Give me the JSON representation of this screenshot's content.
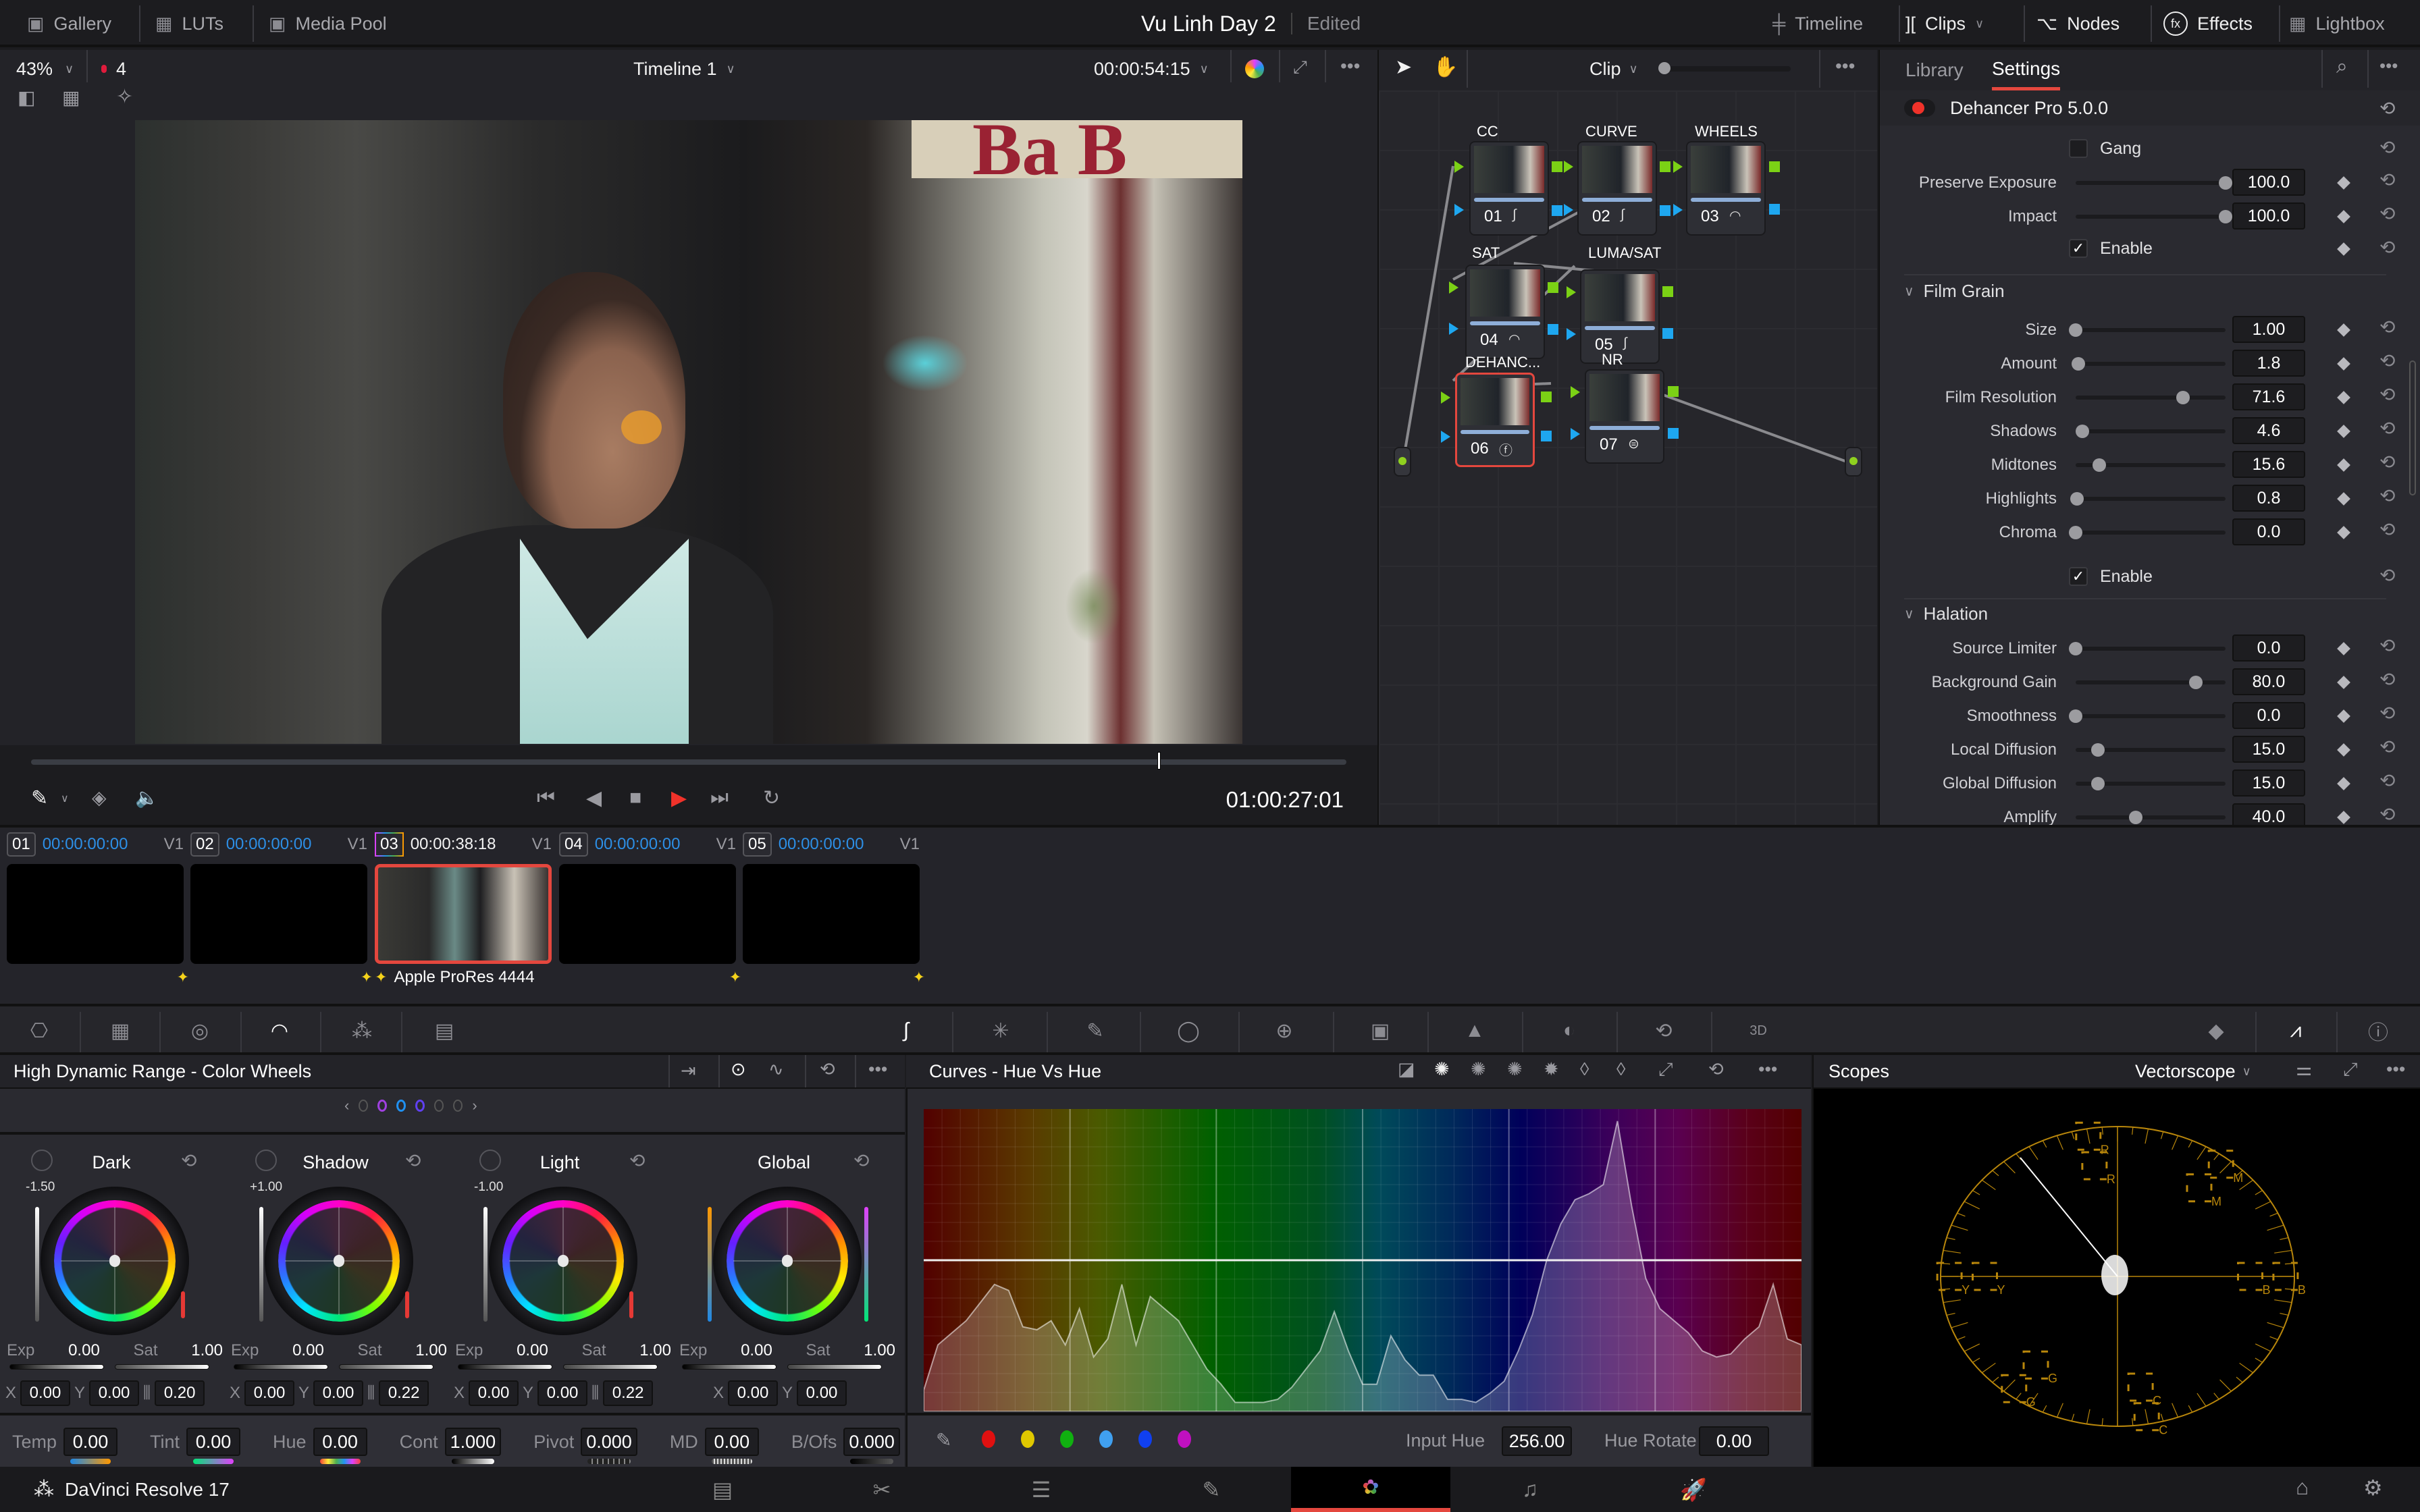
{
  "topbar": {
    "left_items": [
      {
        "label": "Gallery",
        "icon": "gallery-icon"
      },
      {
        "label": "LUTs",
        "icon": "luts-icon"
      },
      {
        "label": "Media Pool",
        "icon": "media-pool-icon"
      }
    ],
    "project_title": "Vu Linh Day 2",
    "project_status": "Edited",
    "right_items": [
      {
        "label": "Timeline",
        "icon": "timeline-icon",
        "active": false
      },
      {
        "label": "Clips",
        "icon": "clips-icon",
        "active": true,
        "dropdown": true
      },
      {
        "label": "Nodes",
        "icon": "nodes-icon",
        "active": true
      },
      {
        "label": "Effects",
        "icon": "effects-icon",
        "active": true
      },
      {
        "label": "Lightbox",
        "icon": "lightbox-icon",
        "active": false
      }
    ]
  },
  "viewer": {
    "zoom": "43%",
    "marker_count": "4",
    "timeline_name": "Timeline 1",
    "source_timecode": "00:00:54:15",
    "record_timecode": "01:00:27:01",
    "playhead_fraction": 0.86,
    "sign_text": "Ba B"
  },
  "node_editor": {
    "mode": "Clip",
    "nodes": [
      {
        "num": "01",
        "label": "CC",
        "icon": "curves-icon",
        "glyph": "∫"
      },
      {
        "num": "02",
        "label": "CURVE",
        "icon": "curves-icon",
        "glyph": "∫"
      },
      {
        "num": "03",
        "label": "WHEELS",
        "icon": "hdr-icon",
        "glyph": "◠"
      },
      {
        "num": "04",
        "label": "SAT",
        "icon": "hdr-icon",
        "glyph": "◠"
      },
      {
        "num": "05",
        "label": "LUMA/SAT",
        "icon": "curves-icon",
        "glyph": "∫"
      },
      {
        "num": "06",
        "label": "DEHANC...",
        "icon": "fx-icon",
        "glyph": "ⓕ",
        "selected": true
      },
      {
        "num": "07",
        "label": "NR",
        "icon": "noise-reduction-icon",
        "glyph": "⊜"
      }
    ]
  },
  "settings": {
    "tabs": [
      "Library",
      "Settings"
    ],
    "active_tab": "Settings",
    "plugin_name": "Dehancer Pro 5.0.0",
    "gang_label": "Gang",
    "gang_checked": false,
    "top_params": [
      {
        "label": "Preserve Exposure",
        "value": "100.0",
        "fraction": 1.0
      },
      {
        "label": "Impact",
        "value": "100.0",
        "fraction": 1.0
      }
    ],
    "enable_label": "Enable",
    "film_grain": {
      "title": "Film Grain",
      "params": [
        {
          "label": "Size",
          "value": "1.00",
          "fraction": 0.0
        },
        {
          "label": "Amount",
          "value": "1.8",
          "fraction": 0.02
        },
        {
          "label": "Film Resolution",
          "value": "71.6",
          "fraction": 0.716
        },
        {
          "label": "Shadows",
          "value": "4.6",
          "fraction": 0.046
        },
        {
          "label": "Midtones",
          "value": "15.6",
          "fraction": 0.156
        },
        {
          "label": "Highlights",
          "value": "0.8",
          "fraction": 0.008
        },
        {
          "label": "Chroma",
          "value": "0.0",
          "fraction": 0.0
        }
      ]
    },
    "halation": {
      "title": "Halation",
      "params": [
        {
          "label": "Source Limiter",
          "value": "0.0",
          "fraction": 0.0
        },
        {
          "label": "Background Gain",
          "value": "80.0",
          "fraction": 0.8
        },
        {
          "label": "Smoothness",
          "value": "0.0",
          "fraction": 0.0
        },
        {
          "label": "Local Diffusion",
          "value": "15.0",
          "fraction": 0.15
        },
        {
          "label": "Global Diffusion",
          "value": "15.0",
          "fraction": 0.15
        },
        {
          "label": "Amplify",
          "value": "40.0",
          "fraction": 0.4
        }
      ]
    }
  },
  "clips": [
    {
      "num": "01",
      "tc": "00:00:00:00",
      "track": "V1",
      "active": false,
      "codec": ""
    },
    {
      "num": "02",
      "tc": "00:00:00:00",
      "track": "V1",
      "active": false,
      "codec": ""
    },
    {
      "num": "03",
      "tc": "00:00:38:18",
      "track": "V1",
      "active": true,
      "codec": "Apple ProRes 4444"
    },
    {
      "num": "04",
      "tc": "00:00:00:00",
      "track": "V1",
      "active": false,
      "codec": ""
    },
    {
      "num": "05",
      "tc": "00:00:00:00",
      "track": "V1",
      "active": false,
      "codec": ""
    }
  ],
  "wheels": {
    "title": "High Dynamic Range - Color Wheels",
    "zones": [
      {
        "name": "Dark",
        "zone_value": "-1.50",
        "exp": "0.00",
        "sat": "1.00",
        "x": "0.00",
        "y": "0.00",
        "falloff": "0.20"
      },
      {
        "name": "Shadow",
        "zone_value": "+1.00",
        "exp": "0.00",
        "sat": "1.00",
        "x": "0.00",
        "y": "0.00",
        "falloff": "0.22"
      },
      {
        "name": "Light",
        "zone_value": "-1.00",
        "exp": "0.00",
        "sat": "1.00",
        "x": "0.00",
        "y": "0.00",
        "falloff": "0.22"
      },
      {
        "name": "Global",
        "zone_value": "",
        "exp": "0.00",
        "sat": "1.00",
        "x": "0.00",
        "y": "0.00",
        "falloff": ""
      }
    ],
    "labels": {
      "exp": "Exp",
      "sat": "Sat",
      "x": "X",
      "y": "Y"
    },
    "footer": [
      {
        "label": "Temp",
        "value": "0.00"
      },
      {
        "label": "Tint",
        "value": "0.00"
      },
      {
        "label": "Hue",
        "value": "0.00"
      },
      {
        "label": "Cont",
        "value": "1.000"
      },
      {
        "label": "Pivot",
        "value": "0.000"
      },
      {
        "label": "MD",
        "value": "0.00"
      },
      {
        "label": "B/Ofs",
        "value": "0.000"
      }
    ]
  },
  "curves": {
    "title": "Curves - Hue Vs Hue",
    "input_hue_label": "Input Hue",
    "input_hue": "256.00",
    "hue_rotate_label": "Hue Rotate",
    "hue_rotate": "0.00",
    "swatches": [
      "#e01010",
      "#e0c800",
      "#10b010",
      "#40a0f0",
      "#1040f0",
      "#c010c0"
    ]
  },
  "scopes": {
    "title": "Scopes",
    "type": "Vectorscope",
    "targets": [
      "R",
      "M",
      "B",
      "C",
      "G",
      "Y"
    ]
  },
  "app": {
    "name": "DaVinci Resolve 17",
    "pages": [
      "Media",
      "Cut",
      "Edit",
      "Fusion",
      "Color",
      "Fairlight",
      "Deliver"
    ],
    "active_page": "Color"
  }
}
